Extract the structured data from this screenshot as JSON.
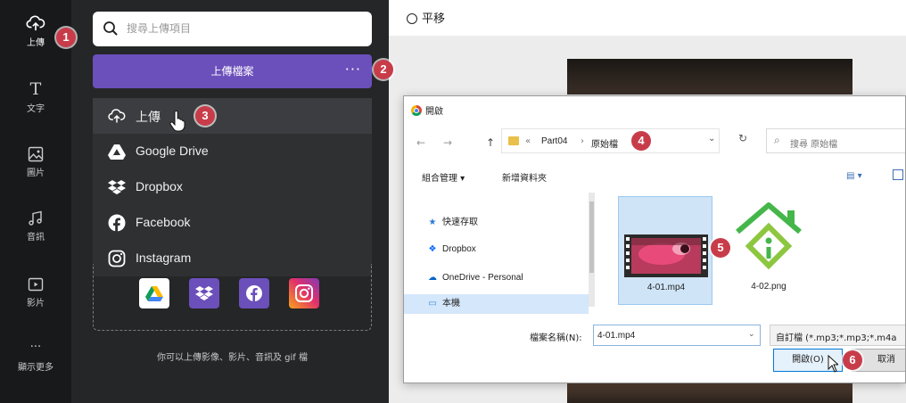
{
  "rail": {
    "items": [
      {
        "label": "上傳",
        "icon": "cloud-upload-icon",
        "active": true
      },
      {
        "label": "文字",
        "icon": "text-icon"
      },
      {
        "label": "圖片",
        "icon": "image-icon"
      },
      {
        "label": "音訊",
        "icon": "music-icon"
      },
      {
        "label": "影片",
        "icon": "video-icon"
      },
      {
        "label": "顯示更多",
        "icon": "more-icon"
      }
    ],
    "text_glyph": "T",
    "more_glyph": "···"
  },
  "panel": {
    "search_placeholder": "搜尋上傳項目",
    "upload_button": "上傳檔案",
    "more_dots": "···",
    "menu": [
      {
        "label": "上傳",
        "icon": "cloud-upload-icon"
      },
      {
        "label": "Google Drive",
        "icon": "google-drive-icon"
      },
      {
        "label": "Dropbox",
        "icon": "dropbox-icon"
      },
      {
        "label": "Facebook",
        "icon": "facebook-icon"
      },
      {
        "label": "Instagram",
        "icon": "instagram-icon"
      }
    ],
    "hint": "你可以上傳影像、影片、音訊及 gif 檔",
    "collapse_glyph": "‹"
  },
  "editor": {
    "pan_label": "平移"
  },
  "dialog": {
    "title": "開啟",
    "back_glyph": "←",
    "forward_glyph": "→",
    "up_glyph": "↑",
    "breadcrumb": [
      "«",
      "Part04",
      "›",
      "原始檔"
    ],
    "address_chevron": "⌄",
    "refresh_glyph": "↻",
    "search_icon_glyph": "⌕",
    "search_placeholder": "搜尋 原始檔",
    "toolbar": {
      "organize": "組合管理 ▾",
      "new_folder": "新增資料夾",
      "view_glyph": "▤ ▾"
    },
    "nav": [
      {
        "label": "快速存取",
        "icon": "star-icon",
        "glyph": "★",
        "color": "#2d7bd4"
      },
      {
        "label": "Dropbox",
        "icon": "dropbox-icon",
        "glyph": "❖",
        "color": "#0061ff"
      },
      {
        "label": "OneDrive - Personal",
        "icon": "onedrive-icon",
        "glyph": "☁",
        "color": "#0a64c8"
      },
      {
        "label": "本機",
        "icon": "computer-icon",
        "glyph": "▭",
        "color": "#3d8fd6"
      }
    ],
    "files": [
      {
        "name": "4-01.mp4",
        "icon": "video-file-icon",
        "selected": true
      },
      {
        "name": "4-02.png",
        "icon": "image-file-icon"
      }
    ],
    "filename_label": "檔案名稱(N):",
    "filename_value": "4-01.mp4",
    "filename_chevron": "⌄",
    "filetype": "自訂檔 (*.mp3;*.mp3;*.m4a",
    "open_button": "開啟(O)",
    "cancel_button": "取消"
  },
  "callouts": [
    "1",
    "2",
    "3",
    "4",
    "5",
    "6"
  ],
  "colors": {
    "accent": "#6b4fbb",
    "badge": "#c83c4a",
    "rail": "#18191b",
    "panel": "#252627"
  }
}
